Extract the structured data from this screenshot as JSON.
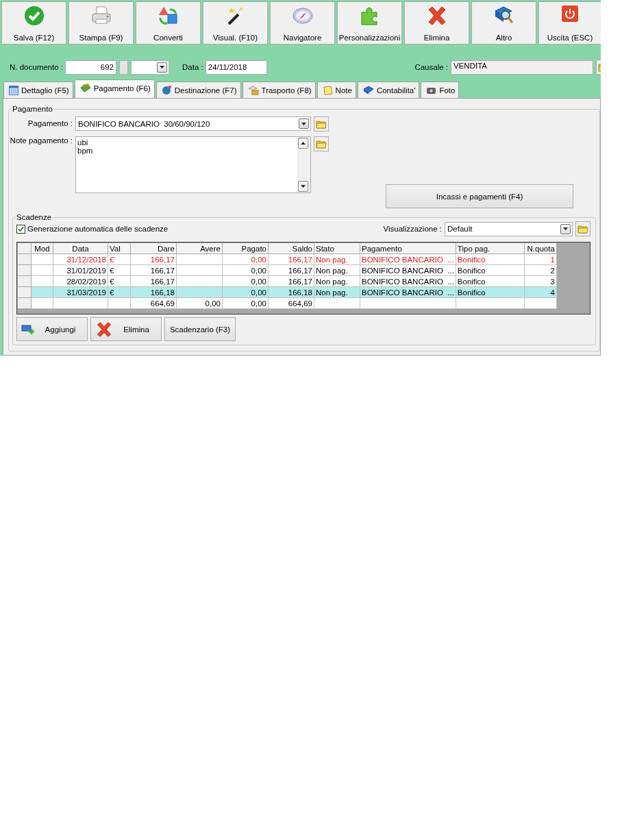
{
  "toolbar": [
    {
      "label": "Salva (F12)"
    },
    {
      "label": "Stampa (F9)"
    },
    {
      "label": "Converti"
    },
    {
      "label": "Visual. (F10)"
    },
    {
      "label": "Navigatore"
    },
    {
      "label": "Personalizzazioni"
    },
    {
      "label": "Elimina"
    },
    {
      "label": "Altro"
    },
    {
      "label": "Uscita (ESC)"
    }
  ],
  "header": {
    "document_number_label": "N. documento :",
    "document_number": "692",
    "date_label": "Data :",
    "date": "24/11/2018",
    "causale_label": "Causale :",
    "causale": "VENDITA"
  },
  "tabs": [
    {
      "label": "Dettaglio (F5)",
      "selected": false
    },
    {
      "label": "Pagamento (F6)",
      "selected": true
    },
    {
      "label": "Destinazione (F7)",
      "selected": false
    },
    {
      "label": "Trasporto (F8)",
      "selected": false
    },
    {
      "label": "Note",
      "selected": false
    },
    {
      "label": "Contabilita'",
      "selected": false
    },
    {
      "label": "Foto",
      "selected": false
    }
  ],
  "payment": {
    "title": "Pagamento",
    "method_label": "Pagamento :",
    "method": "BONIFICO BANCARIO  30/60/90/120",
    "notes_label": "Note pagamento :",
    "notes": "ubi\nbpm",
    "incassi_button": "Incassi e pagamenti (F4)"
  },
  "schedule": {
    "title": "Scadenze",
    "auto_generate": {
      "label": "Generazione automatica delle scadenze",
      "checked": true
    },
    "view_label": "Visualizzazione :",
    "view": "Default",
    "table": {
      "columns": [
        "Mod",
        "Data",
        "Val",
        "Dare",
        "Avere",
        "Pagato",
        "Saldo",
        "Stato",
        "Pagamento",
        "Tipo pag.",
        "N.quota"
      ],
      "rows": [
        {
          "overdue": true,
          "selected": false,
          "data": "31/12/2018",
          "val": "€",
          "dare": "166,17",
          "pagato": "0,00",
          "saldo": "166,17",
          "stato": "Non pag.",
          "pagamento": "BONIFICO BANCARIO  ...",
          "tipo_pag": "Bonifico",
          "n_quota": "1"
        },
        {
          "overdue": false,
          "selected": false,
          "data": "31/01/2019",
          "val": "€",
          "dare": "166,17",
          "pagato": "0,00",
          "saldo": "166,17",
          "stato": "Non pag.",
          "pagamento": "BONIFICO BANCARIO  ...",
          "tipo_pag": "Bonifico",
          "n_quota": "2"
        },
        {
          "overdue": false,
          "selected": false,
          "data": "28/02/2019",
          "val": "€",
          "dare": "166,17",
          "pagato": "0,00",
          "saldo": "166,17",
          "stato": "Non pag.",
          "pagamento": "BONIFICO BANCARIO  ...",
          "tipo_pag": "Bonifico",
          "n_quota": "3"
        },
        {
          "overdue": false,
          "selected": true,
          "data": "31/03/2019",
          "val": "€",
          "dare": "166,18",
          "pagato": "0,00",
          "saldo": "166,18",
          "stato": "Non pag.",
          "pagamento": "BONIFICO BANCARIO  ...",
          "tipo_pag": "Bonifico",
          "n_quota": "4"
        }
      ],
      "totals": {
        "dare": "664,69",
        "avere": "0,00",
        "pagato": "0,00",
        "saldo": "664,69"
      }
    },
    "buttons": [
      {
        "label": "Aggiungi"
      },
      {
        "label": "Elimina"
      },
      {
        "label": "Scadenzario (F3)"
      }
    ]
  }
}
